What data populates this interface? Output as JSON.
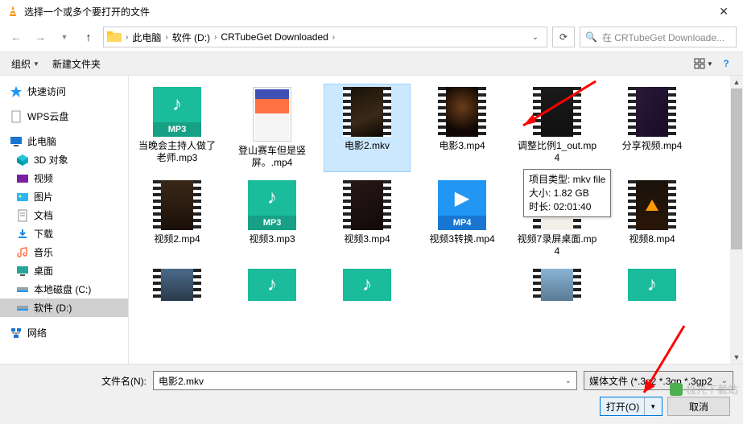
{
  "window": {
    "title": "选择一个或多个要打开的文件"
  },
  "breadcrumb": {
    "pc": "此电脑",
    "drive": "软件 (D:)",
    "folder": "CRTubeGet Downloaded"
  },
  "search": {
    "placeholder": "在 CRTubeGet Downloade..."
  },
  "toolbar": {
    "organize": "组织",
    "newfolder": "新建文件夹"
  },
  "sidebar": {
    "quick": "快速访问",
    "wps": "WPS云盘",
    "pc": "此电脑",
    "objects3d": "3D 对象",
    "videos": "视频",
    "pictures": "图片",
    "documents": "文档",
    "downloads": "下载",
    "music": "音乐",
    "desktop": "桌面",
    "cdrive": "本地磁盘 (C:)",
    "ddrive": "软件 (D:)",
    "network": "网络"
  },
  "files": {
    "f1": "当晚会主持人做了老师.mp3",
    "f2": "登山赛车但是竖屏。.mp4",
    "f3": "电影2.mkv",
    "f4": "电影3.mp4",
    "f5": "调整比例1_out.mp4",
    "f6": "分享视频.mp4",
    "f7": "视频2.mp4",
    "f8": "视频3.mp3",
    "f9": "视频3.mp4",
    "f10": "视频3转换.mp4",
    "f11": "视频7录屏桌面.mp4",
    "f12": "视频8.mp4"
  },
  "tooltip": {
    "l1": "项目类型: mkv file",
    "l2": "大小: 1.82 GB",
    "l3": "时长: 02:01:40"
  },
  "bottom": {
    "fname_label": "文件名(N):",
    "fname_value": "电影2.mkv",
    "filter": "媒体文件 (*.3g2 *.3gp *.3gp2",
    "open": "打开(O)",
    "cancel": "取消"
  },
  "watermark": "极光下载站",
  "mp3_label": "MP3",
  "mp4_label": "MP4"
}
